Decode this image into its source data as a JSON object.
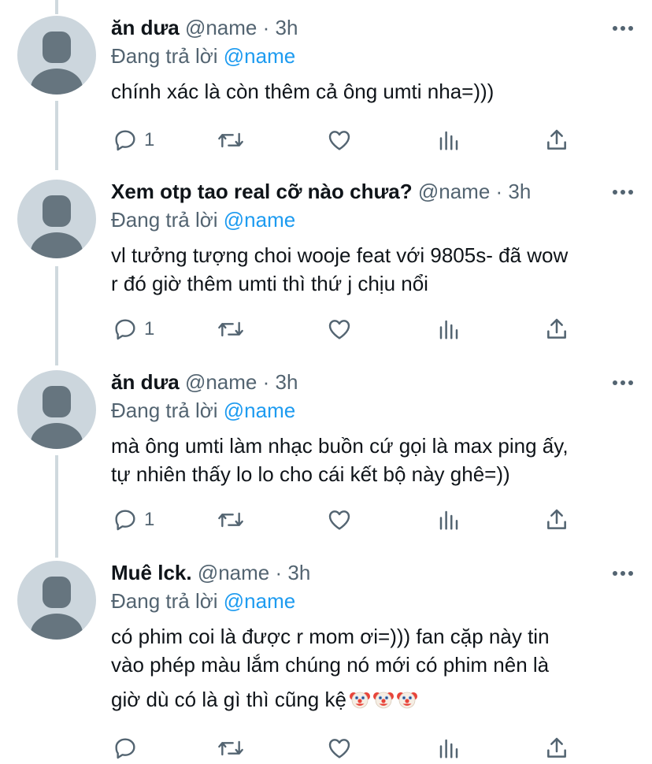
{
  "tweets": [
    {
      "display_name": "ăn dưa",
      "meta": " @name · 3h",
      "reply_prefix": "Đang trả lời ",
      "reply_mention": "@name",
      "lines": [
        "chính xác là còn thêm cả ông umti nha=)))"
      ],
      "reply_count": "1"
    },
    {
      "display_name": "Xem otp tao real cỡ nào chưa?",
      "meta": " @name · 3h",
      "reply_prefix": "Đang trả lời ",
      "reply_mention": "@name",
      "lines": [
        "vl tưởng tượng choi wooje feat với 9805s- đã wow",
        "r đó giờ thêm umti thì thứ j chịu nổi"
      ],
      "reply_count": "1"
    },
    {
      "display_name": "ăn dưa",
      "meta": " @name · 3h",
      "reply_prefix": "Đang trả lời ",
      "reply_mention": "@name",
      "lines": [
        "mà ông umti làm nhạc buồn cứ gọi là max ping ấy,",
        "tự nhiên thấy lo lo cho cái kết bộ này ghê=))"
      ],
      "reply_count": "1"
    },
    {
      "display_name": "Muê lck.",
      "meta": " @name · 3h",
      "reply_prefix": "Đang trả lời ",
      "reply_mention": "@name",
      "lines": [
        "có phim coi là được r mom ơi=))) fan cặp này tin",
        "vào phép màu lắm chúng nó mới có phim nên là",
        "giờ dù có là gì thì cũng kệ"
      ],
      "emoji": [
        "clown-face",
        "clown-face",
        "clown-face"
      ],
      "reply_count": ""
    }
  ],
  "colors": {
    "mention": "#1d9bf0",
    "secondary_text": "#536471",
    "icon": "#536471",
    "avatar_bg": "#ccd6dd",
    "thread_line": "#cfd9de"
  },
  "icons": [
    "reply-icon",
    "retweet-icon",
    "like-icon",
    "views-icon",
    "share-icon",
    "more-icon"
  ]
}
